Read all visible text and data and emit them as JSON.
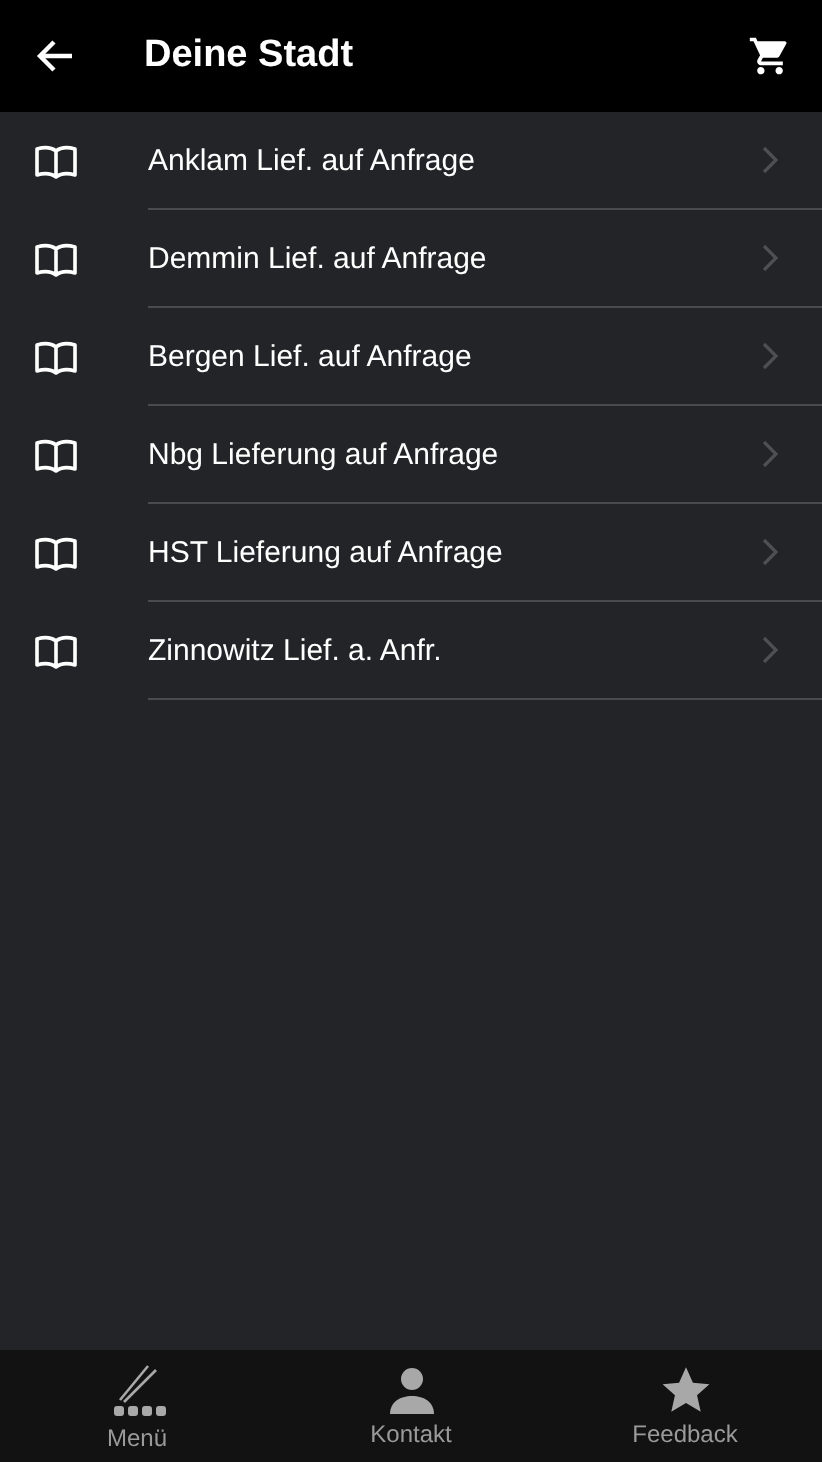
{
  "header": {
    "title": "Deine Stadt"
  },
  "items": [
    {
      "label": "Anklam Lief. auf Anfrage"
    },
    {
      "label": "Demmin Lief. auf Anfrage"
    },
    {
      "label": "Bergen Lief. auf Anfrage"
    },
    {
      "label": "Nbg Lieferung auf Anfrage"
    },
    {
      "label": "HST Lieferung auf Anfrage"
    },
    {
      "label": "Zinnowitz Lief. a. Anfr."
    }
  ],
  "tab_bar": [
    {
      "label": "Menü",
      "kind": "menu"
    },
    {
      "label": "Kontakt",
      "kind": "contact"
    },
    {
      "label": "Feedback",
      "kind": "feedback"
    }
  ]
}
